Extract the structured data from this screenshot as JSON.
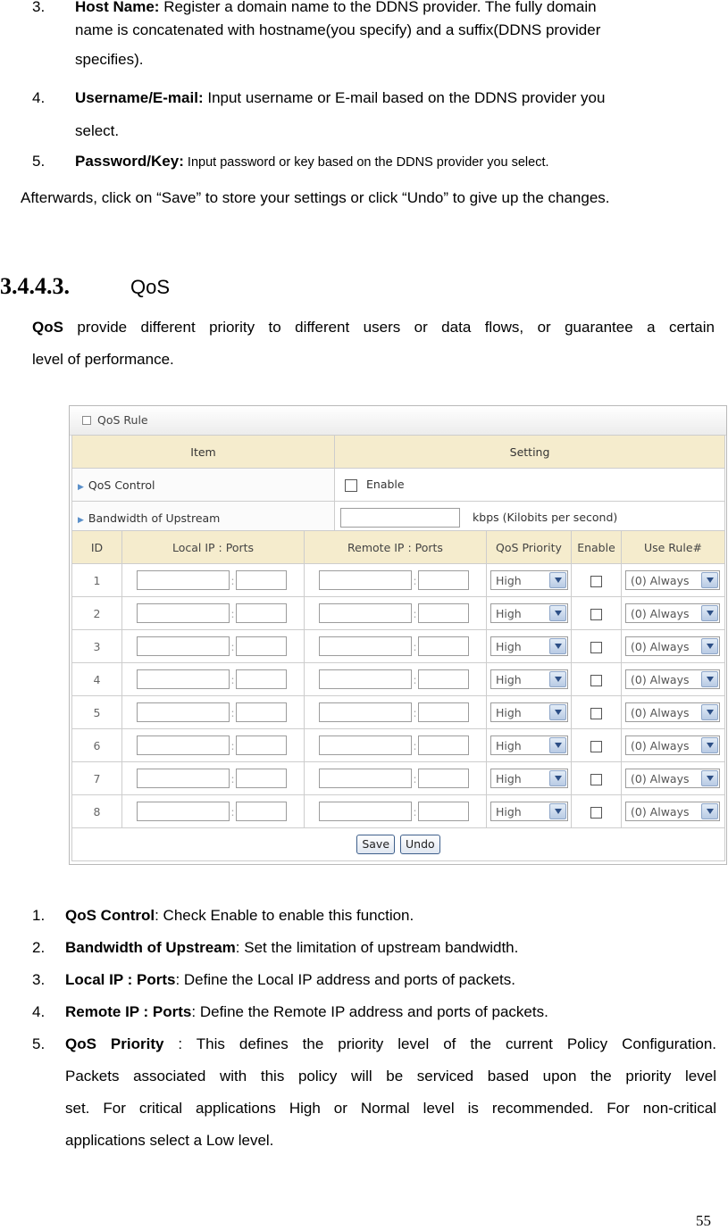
{
  "intro_list": [
    {
      "num": "3.",
      "term": "Host Name:",
      "text": " Register a domain name to the DDNS provider. The fully domain",
      "cont": [
        "name is concatenated with hostname(you specify) and a suffix(DDNS provider",
        "specifies)."
      ]
    },
    {
      "num": "4.",
      "term": "Username/E-mail:",
      "text": " Input username or E-mail based on the DDNS provider you",
      "cont": [
        "select."
      ]
    },
    {
      "num": "5.",
      "term": "Password/Key:",
      "text": " Input password or key based on the DDNS provider you select.",
      "cont": []
    }
  ],
  "afterwards": "Afterwards, click on “Save” to store your settings or click “Undo” to give up the changes.",
  "section": {
    "number": "3.4.4.3.",
    "title": "QoS"
  },
  "qos_intro": {
    "term": "QoS",
    "text_line1": " provide different priority to different users or data flows, or guarantee a certain",
    "text_line2": "level of performance."
  },
  "panel": {
    "title": "QoS Rule",
    "header": {
      "item": "Item",
      "setting": "Setting"
    },
    "qos_control_label": "QoS Control",
    "enable_label": "Enable",
    "bandwidth_label": "Bandwidth of Upstream",
    "bandwidth_value": "",
    "bandwidth_unit": "kbps (Kilobits per second)",
    "columns": [
      "ID",
      "Local IP : Ports",
      "Remote IP : Ports",
      "QoS Priority",
      "Enable",
      "Use Rule#"
    ],
    "rows": [
      {
        "id": "1",
        "priority": "High",
        "rule": "(0) Always"
      },
      {
        "id": "2",
        "priority": "High",
        "rule": "(0) Always"
      },
      {
        "id": "3",
        "priority": "High",
        "rule": "(0) Always"
      },
      {
        "id": "4",
        "priority": "High",
        "rule": "(0) Always"
      },
      {
        "id": "5",
        "priority": "High",
        "rule": "(0) Always"
      },
      {
        "id": "6",
        "priority": "High",
        "rule": "(0) Always"
      },
      {
        "id": "7",
        "priority": "High",
        "rule": "(0) Always"
      },
      {
        "id": "8",
        "priority": "High",
        "rule": "(0) Always"
      }
    ],
    "save_label": "Save",
    "undo_label": "Undo"
  },
  "desc_list": [
    {
      "num": "1.",
      "term": "QoS Control",
      "text": ": Check Enable to enable this function."
    },
    {
      "num": "2.",
      "term": "Bandwidth of Upstream",
      "text": ": Set the limitation of upstream bandwidth."
    },
    {
      "num": "3.",
      "term": "Local IP : Ports",
      "text": ": Define the Local IP address and ports of packets."
    },
    {
      "num": "4.",
      "term": "Remote IP : Ports",
      "text": ": Define the Remote IP address and ports of packets."
    },
    {
      "num": "5.",
      "term": "QoS Priority",
      "text": " : This defines the priority level of the current Policy Configuration.",
      "cont": [
        "Packets associated with this policy will be serviced based upon the priority level",
        "set. For critical applications High or Normal level is recommended. For non-critical",
        "applications select a Low level."
      ]
    }
  ],
  "page_number": "55"
}
